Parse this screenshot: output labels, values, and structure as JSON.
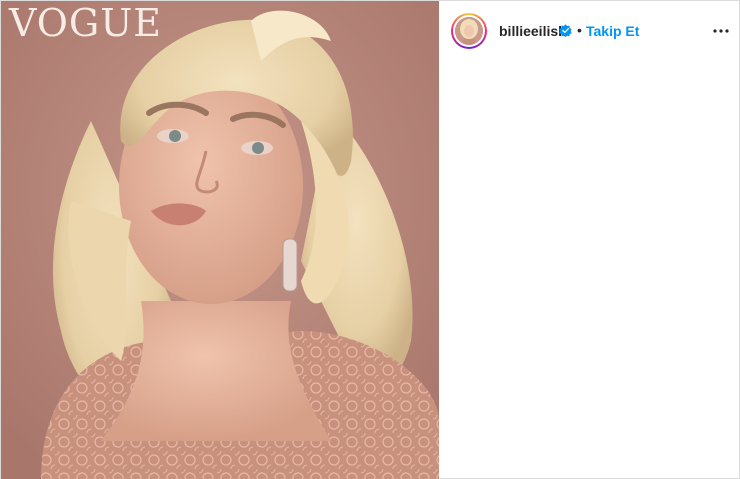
{
  "post": {
    "image": {
      "masthead": "VOGUE",
      "description_icon": "portrait-photo"
    },
    "header": {
      "username": "billieeilish",
      "verified_icon": "verified-badge-icon",
      "separator": "•",
      "follow_label": "Takip Et",
      "more_icon": "more-options-icon"
    }
  },
  "colors": {
    "background_photo": "#b98679",
    "follow_blue": "#0095f6",
    "verified_blue": "#0095f6",
    "text_dark": "#262626"
  }
}
